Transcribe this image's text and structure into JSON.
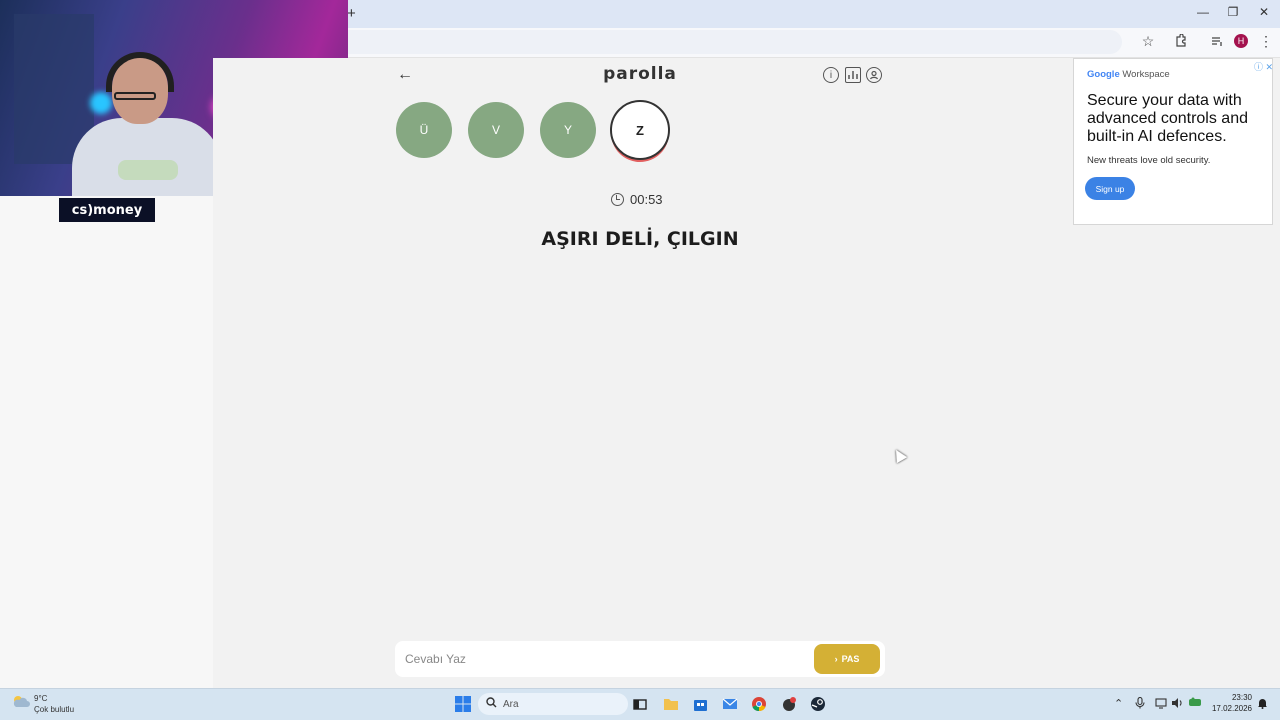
{
  "browser": {
    "new_tab_glyph": "+",
    "window_controls": {
      "minimize": "—",
      "restore": "❐",
      "close": "✕"
    },
    "profile_initial": "H"
  },
  "overlay": {
    "sponsor": "cs)money"
  },
  "game": {
    "title": "parolla",
    "letters": [
      {
        "char": "Ü",
        "state": "done"
      },
      {
        "char": "V",
        "state": "done"
      },
      {
        "char": "Y",
        "state": "done"
      },
      {
        "char": "Z",
        "state": "current"
      }
    ],
    "timer": "00:53",
    "clue": "AŞIRI DELİ, ÇILGIN",
    "answer_placeholder": "Cevabı Yaz",
    "pass_label": "PAS",
    "colors": {
      "done": "#86a882",
      "current_ring": "#e26060",
      "pass": "#d4b035"
    }
  },
  "ad": {
    "brand_google": "Google",
    "brand_product": "Workspace",
    "headline": "Secure your data with advanced controls and built-in AI defences.",
    "subtext": "New threats love old security.",
    "cta": "Sign up"
  },
  "taskbar": {
    "weather_temp": "9°C",
    "weather_desc": "Çok bulutlu",
    "search_label": "Ara",
    "time": "23:30",
    "date": "17.02.2026"
  }
}
